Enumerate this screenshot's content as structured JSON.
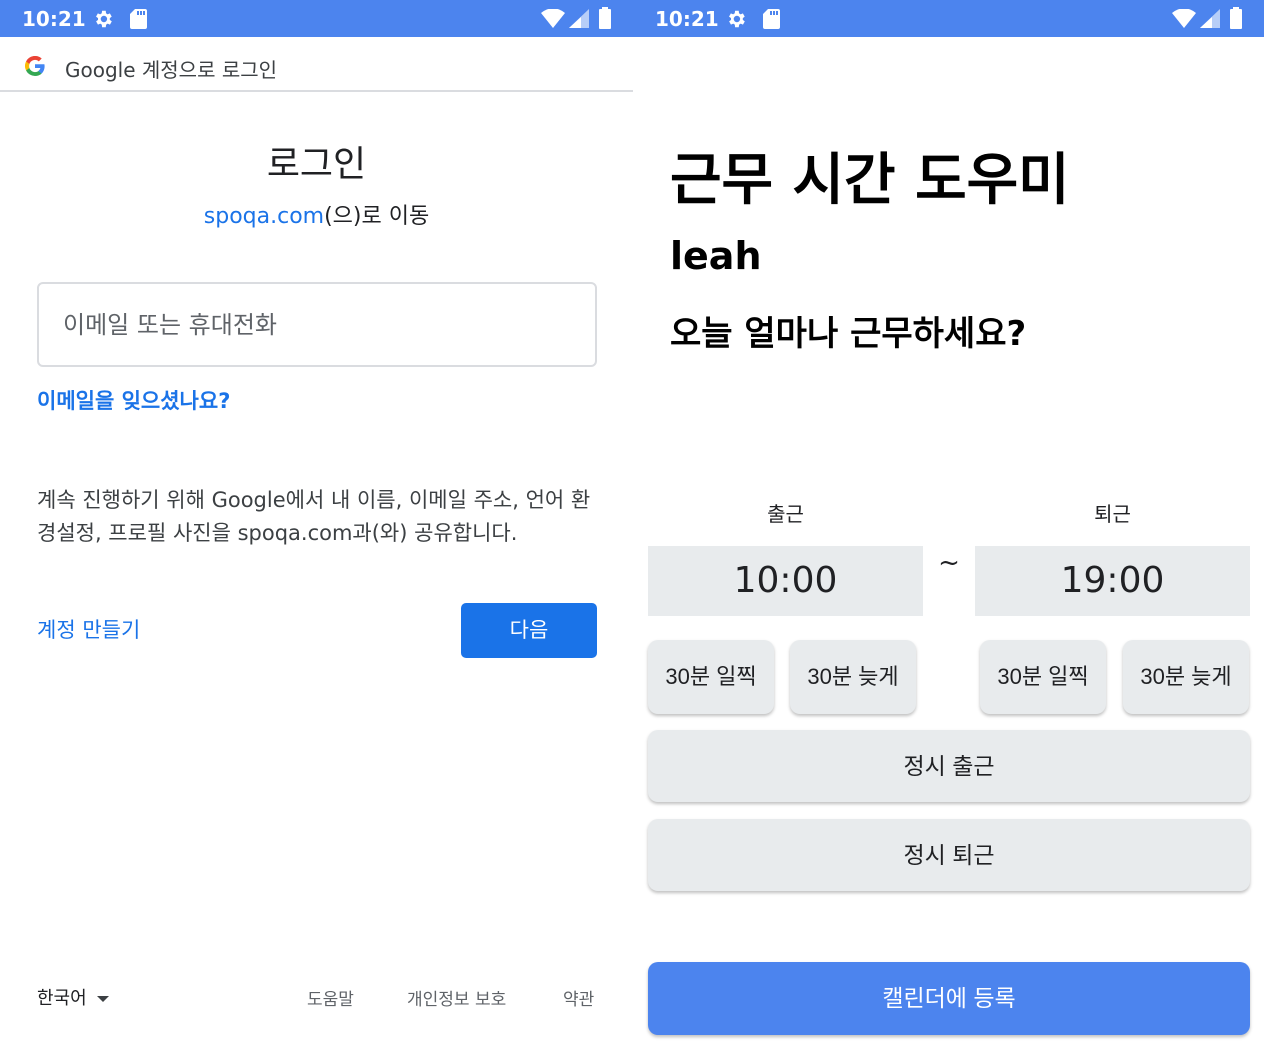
{
  "left": {
    "status": {
      "time": "10:21"
    },
    "header_title": "Google 계정으로 로그인",
    "signin_title": "로그인",
    "continue_link": "spoqa.com",
    "continue_text": "(으)로 이동",
    "email_placeholder": "이메일 또는 휴대전화",
    "forgot_email": "이메일을 잊으셨나요?",
    "info_text": "계속 진행하기 위해 Google에서 내 이름, 이메일 주소, 언어 환경설정, 프로필 사진을 spoqa.com과(와) 공유합니다.",
    "create_account": "계정 만들기",
    "next_button": "다음",
    "language": "한국어",
    "footer": {
      "help": "도움말",
      "privacy": "개인정보 보호",
      "terms": "약관"
    }
  },
  "right": {
    "status": {
      "time": "10:21"
    },
    "title": "근무 시간 도우미",
    "user": "leah",
    "question": "오늘 얼마나 근무하세요?",
    "clock_in_label": "출근",
    "clock_out_label": "퇴근",
    "clock_in_time": "10:00",
    "clock_out_time": "19:00",
    "separator": "~",
    "in_earlier": "30분 일찍",
    "in_later": "30분 늦게",
    "out_earlier": "30분 일찍",
    "out_later": "30분 늦게",
    "on_time_in": "정시 출근",
    "on_time_out": "정시 퇴근",
    "add_to_calendar": "캘린더에 등록"
  },
  "colors": {
    "status_bar": "#4c84ee",
    "google_blue": "#1a73e8",
    "button_gray": "#e8ebed"
  },
  "icons": [
    "gear-icon",
    "sd-card-icon",
    "wifi-icon",
    "signal-icon",
    "battery-icon",
    "google-logo-icon",
    "dropdown-caret-icon"
  ]
}
